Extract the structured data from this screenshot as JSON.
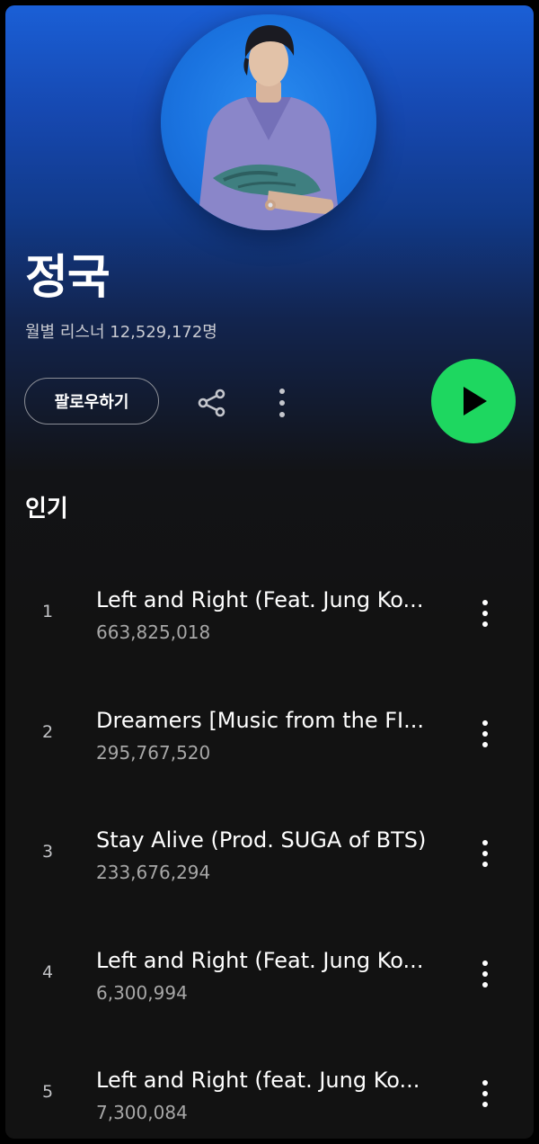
{
  "artist": {
    "name": "정국",
    "monthly_listeners": "월별 리스너 12,529,172명"
  },
  "actions": {
    "follow_label": "팔로우하기",
    "share_icon": "share-icon",
    "more_icon": "more-vertical-icon",
    "play_icon": "play-icon"
  },
  "popular": {
    "title": "인기",
    "tracks": [
      {
        "rank": "1",
        "title": "Left and Right (Feat. Jung Ko...",
        "plays": "663,825,018"
      },
      {
        "rank": "2",
        "title": "Dreamers [Music from the FI...",
        "plays": "295,767,520"
      },
      {
        "rank": "3",
        "title": "Stay Alive (Prod. SUGA of BTS)",
        "plays": "233,676,294"
      },
      {
        "rank": "4",
        "title": "Left and Right (Feat. Jung Ko...",
        "plays": "6,300,994"
      },
      {
        "rank": "5",
        "title": "Left and Right (feat. Jung Ko...",
        "plays": "7,300,084"
      }
    ]
  },
  "colors": {
    "header_gradient_top": "#1a5fd6",
    "background": "#121212",
    "play_button": "#1ed760",
    "secondary_text": "#a7a7a7"
  }
}
